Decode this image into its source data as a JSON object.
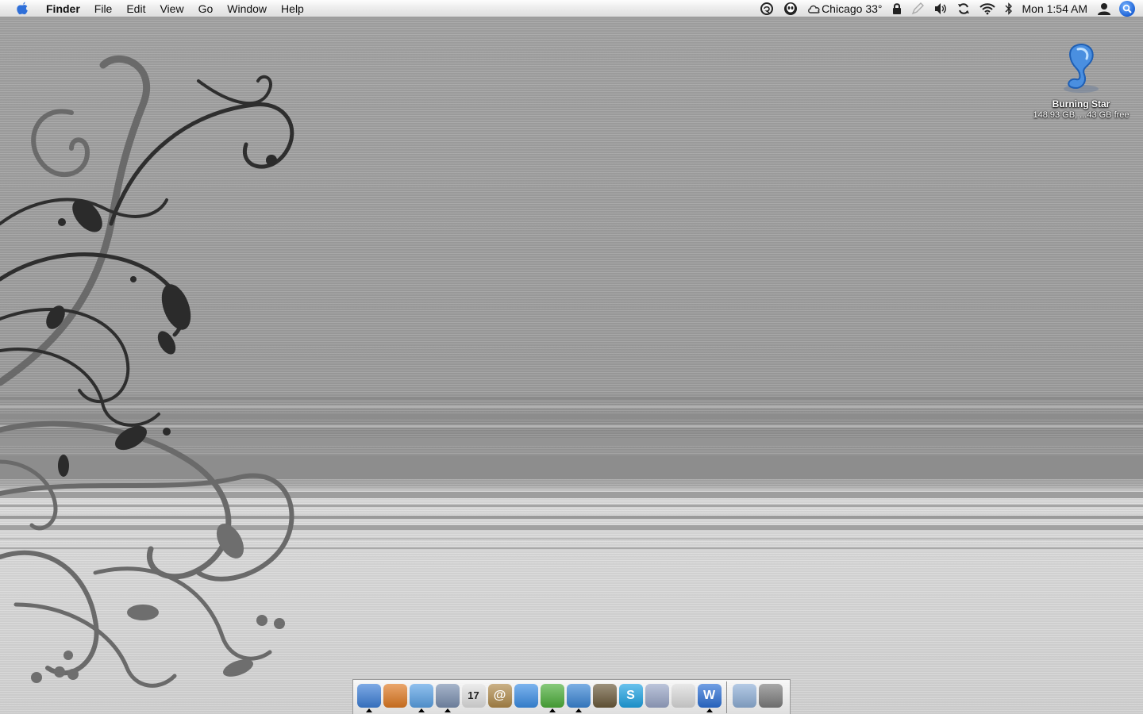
{
  "menubar": {
    "apple_icon": "apple-logo-icon",
    "app_name": "Finder",
    "menus": [
      "File",
      "Edit",
      "View",
      "Go",
      "Window",
      "Help"
    ],
    "status": {
      "weather": "Chicago 33°",
      "clock": "Mon 1:54 AM"
    }
  },
  "desktop": {
    "disk": {
      "name": "Burning Star",
      "info": "148.93 GB, ...43 GB free",
      "icon": "drive-icon"
    }
  },
  "dock": {
    "apps": [
      {
        "icon": "finder-icon",
        "running": true,
        "color": "#3d7fd8"
      },
      {
        "icon": "volcano-icon",
        "running": false,
        "color": "#e07a22"
      },
      {
        "icon": "safari-icon",
        "running": true,
        "color": "#5aa2e6"
      },
      {
        "icon": "mail-icon",
        "running": true,
        "color": "#7a8fb0"
      },
      {
        "icon": "ical-icon",
        "running": false,
        "color": "#e2e2e2",
        "label": "17"
      },
      {
        "icon": "address-book-icon",
        "running": false,
        "color": "#b08a4a",
        "label": "@"
      },
      {
        "icon": "ichat-icon",
        "running": false,
        "color": "#3b8ee6"
      },
      {
        "icon": "adium-icon",
        "running": true,
        "color": "#4caf3a"
      },
      {
        "icon": "itunes-icon",
        "running": true,
        "color": "#3a86d6"
      },
      {
        "icon": "iphoto-icon",
        "running": false,
        "color": "#6b5a3a"
      },
      {
        "icon": "skype-icon",
        "running": false,
        "color": "#1ea3e4",
        "label": "S"
      },
      {
        "icon": "package-icon",
        "running": false,
        "color": "#9aa7c8"
      },
      {
        "icon": "apple-icon",
        "running": false,
        "color": "#dcdcdc"
      },
      {
        "icon": "w-app-icon",
        "running": true,
        "color": "#2b6fd6",
        "label": "W"
      }
    ],
    "docs": [
      {
        "icon": "applications-folder-icon",
        "running": false,
        "color": "#8fb0d8"
      },
      {
        "icon": "trash-icon",
        "running": false,
        "color": "#7d7d7d"
      }
    ]
  }
}
